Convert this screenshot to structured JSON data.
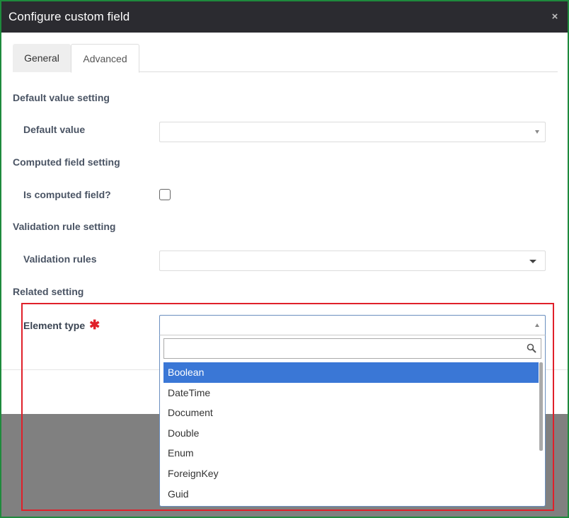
{
  "dialog": {
    "title": "Configure custom field",
    "close_icon": "×"
  },
  "tabs": [
    {
      "label": "General",
      "active": false
    },
    {
      "label": "Advanced",
      "active": true
    }
  ],
  "sections": {
    "default_value": {
      "heading": "Default value setting",
      "field_label": "Default value",
      "value": ""
    },
    "computed": {
      "heading": "Computed field setting",
      "field_label": "Is computed field?",
      "checked": false
    },
    "validation": {
      "heading": "Validation rule setting",
      "field_label": "Validation rules",
      "value": ""
    },
    "related": {
      "heading": "Related setting",
      "field_label": "Element type",
      "required_marker": "✱",
      "value": "",
      "search_placeholder": "",
      "options": [
        "Boolean",
        "DateTime",
        "Document",
        "Double",
        "Enum",
        "ForeignKey",
        "Guid"
      ],
      "selected_option": "Boolean"
    }
  },
  "colors": {
    "title_bar": "#2b2b30",
    "selected_option": "#3a77d6",
    "highlight_border": "#e0202a",
    "frame_border": "#1e8a3c"
  }
}
